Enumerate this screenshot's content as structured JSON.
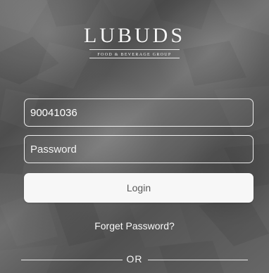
{
  "brand": {
    "name": "LUBUDS",
    "tagline": "FOOD & BEVERAGE GROUP"
  },
  "form": {
    "username_value": "90041036",
    "password_placeholder": "Password",
    "login_label": "Login",
    "forgot_label": "Forget Password?",
    "divider_label": "OR"
  },
  "colors": {
    "background": "#5b5b5b",
    "text": "#f5f5f5",
    "button": "#f7f7f7"
  }
}
